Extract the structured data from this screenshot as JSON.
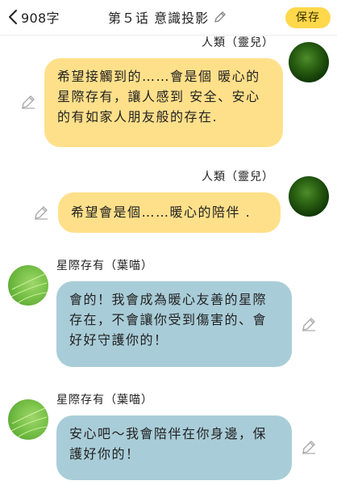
{
  "header": {
    "word_count": "908字",
    "title": "第５话 意識投影",
    "save_label": "保存"
  },
  "messages": [
    {
      "sender": "人類（靈兒）",
      "text": "希望接觸到的……會是個 暖心的星際存有，讓人感到  安全、安心 的有如家人朋友般的存在."
    },
    {
      "sender": "人類（靈兒）",
      "text": "希望會是個……暖心的陪伴 ."
    },
    {
      "sender": "星際存有（葉喵）",
      "text": "會的！我會成為暖心友善的星際存在，不會讓你受到傷害的、會好好守護你的！"
    },
    {
      "sender": "星際存有（葉喵）",
      "text": "安心吧～我會陪伴在你身邊，保護好你的！"
    }
  ],
  "colors": {
    "save_button": "#ffd84c",
    "user_bubble": "#ffe08a",
    "other_bubble": "#a9cdd8"
  },
  "icons": {
    "back": "chevron-left-icon",
    "edit": "pencil-icon"
  }
}
